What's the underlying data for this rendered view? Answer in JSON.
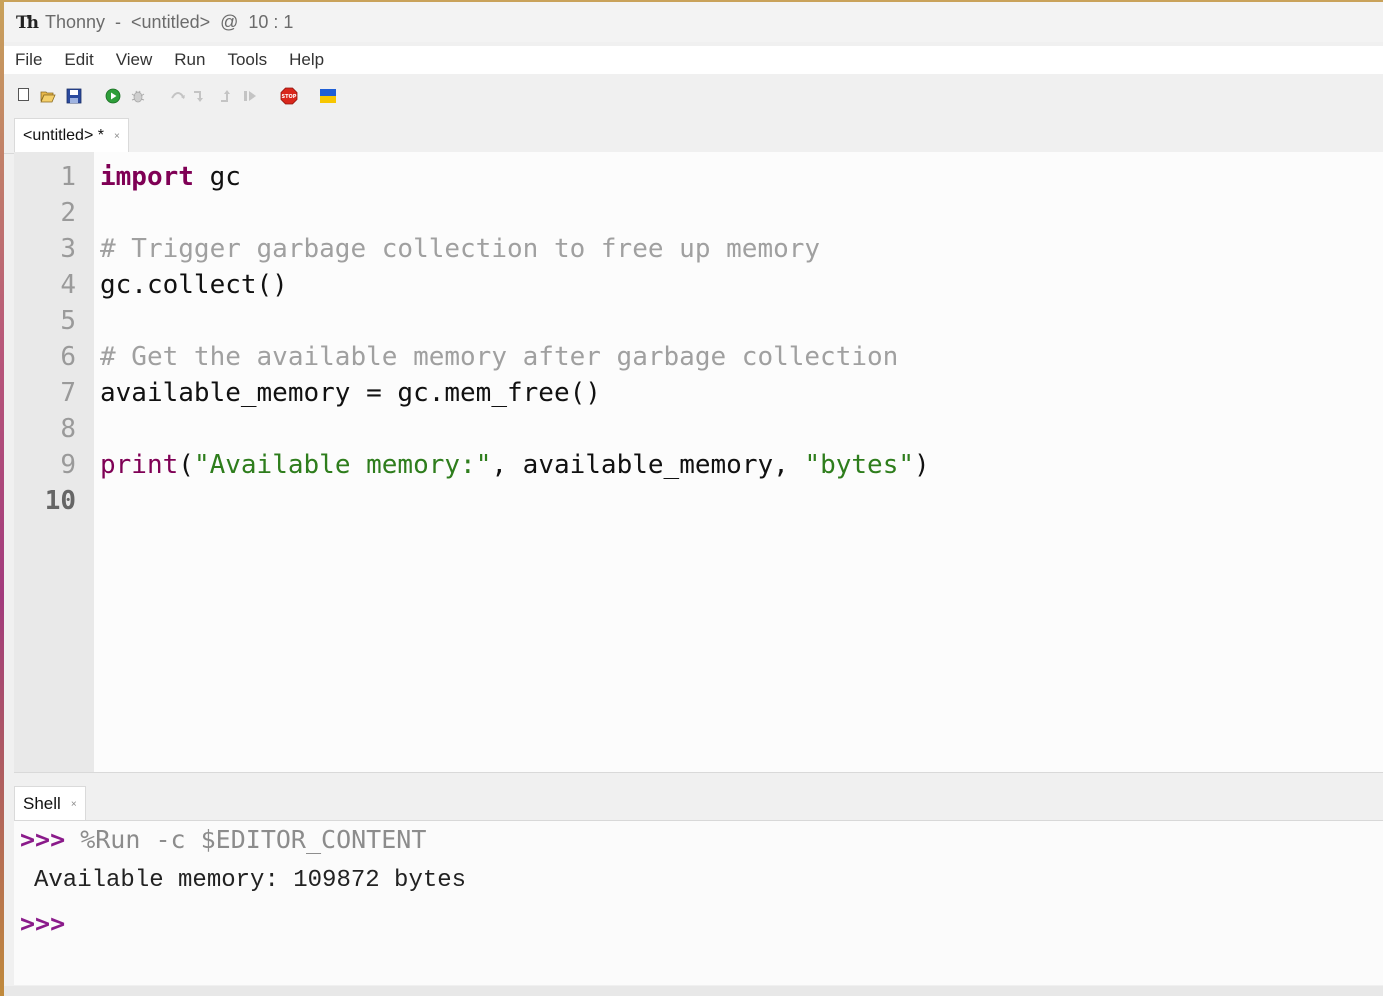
{
  "window": {
    "title": "Thonny  -  <untitled>  @  10 : 1"
  },
  "menu": [
    "File",
    "Edit",
    "View",
    "Run",
    "Tools",
    "Help"
  ],
  "toolbar": {
    "icons": [
      "new-file-icon",
      "open-file-icon",
      "save-file-icon",
      "run-icon",
      "debug-icon",
      "step-over-icon",
      "step-into-icon",
      "step-out-icon",
      "resume-icon",
      "stop-icon",
      "ukraine-flag-icon"
    ],
    "stop_label": "STOP"
  },
  "editor": {
    "tab_label": "<untitled> *",
    "tab_close": "×",
    "line_numbers": [
      "1",
      "2",
      "3",
      "4",
      "5",
      "6",
      "7",
      "8",
      "9",
      "10"
    ],
    "code": {
      "l1_kw": "import",
      "l1_rest": " gc",
      "l3": "# Trigger garbage collection to free up memory",
      "l4": "gc.collect()",
      "l6": "# Get the available memory after garbage collection",
      "l7": "available_memory = gc.mem_free()",
      "l9_fn": "print",
      "l9_open": "(",
      "l9_str1": "\"Available memory:\"",
      "l9_mid": ", available_memory, ",
      "l9_str2": "\"bytes\"",
      "l9_close": ")"
    }
  },
  "shell": {
    "tab_label": "Shell",
    "tab_close": "×",
    "prompt": ">>>",
    "command": " %Run -c $EDITOR_CONTENT",
    "output": "Available memory: 109872 bytes"
  },
  "colors": {
    "keyword": "#7f0055",
    "comment": "#a0a0a0",
    "string": "#2e7d1c",
    "prompt": "#8a1a8a"
  }
}
